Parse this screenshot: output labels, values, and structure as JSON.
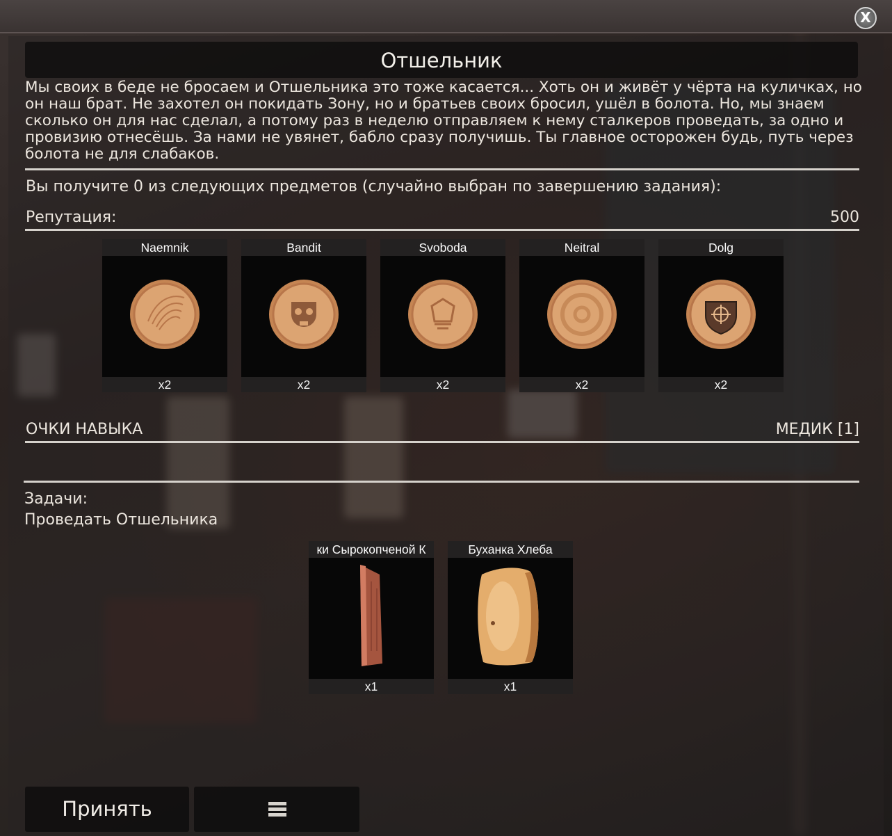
{
  "window": {
    "close_label": "X"
  },
  "quest": {
    "title": "Отшельник",
    "description": "Мы своих в беде не бросаем и Отшельника это тоже касается... Хоть он и живёт у чёрта на куличках, но он наш брат. Не захотел он покидать Зону, но и братьев своих бросил, ушёл в болота. Но, мы знаем сколько он для нас сделал, а потому раз в неделю отправляем к нему сталкеров проведать, за одно и провизию отнесёшь. За нами не увянет, бабло сразу получишь. Ты главное осторожен будь, путь через болота не для слабаков."
  },
  "rewards": {
    "choice_text": "Вы получите 0 из следующих предметов (случайно выбран по завершению задания):",
    "reputation_label": "Репутация:",
    "reputation_value": "500",
    "items": [
      {
        "name": "Naemnik",
        "count": "x2",
        "icon": "naemnik-coin-icon"
      },
      {
        "name": "Bandit",
        "count": "x2",
        "icon": "bandit-coin-icon"
      },
      {
        "name": "Svoboda",
        "count": "x2",
        "icon": "svoboda-coin-icon"
      },
      {
        "name": "Neitral",
        "count": "x2",
        "icon": "neitral-coin-icon"
      },
      {
        "name": "Dolg",
        "count": "x2",
        "icon": "dolg-coin-icon"
      }
    ]
  },
  "skills": {
    "label": "ОЧКИ НАВЫКА",
    "value": "МЕДИК [1]"
  },
  "tasks": {
    "label": "Задачи:",
    "task": "Проведать Отшельника",
    "items": [
      {
        "name": "ки Сырокопченой К",
        "count": "x1",
        "icon": "sausage-icon"
      },
      {
        "name": "Буханка Хлеба",
        "count": "x1",
        "icon": "bread-loaf-icon"
      }
    ]
  },
  "buttons": {
    "accept_label": "Принять",
    "list_icon": "list-icon"
  },
  "colors": {
    "coin": "#d79c67",
    "coin_dark": "#b8764a",
    "panel_dark": "#070707",
    "divider": "#d6d2cc"
  }
}
